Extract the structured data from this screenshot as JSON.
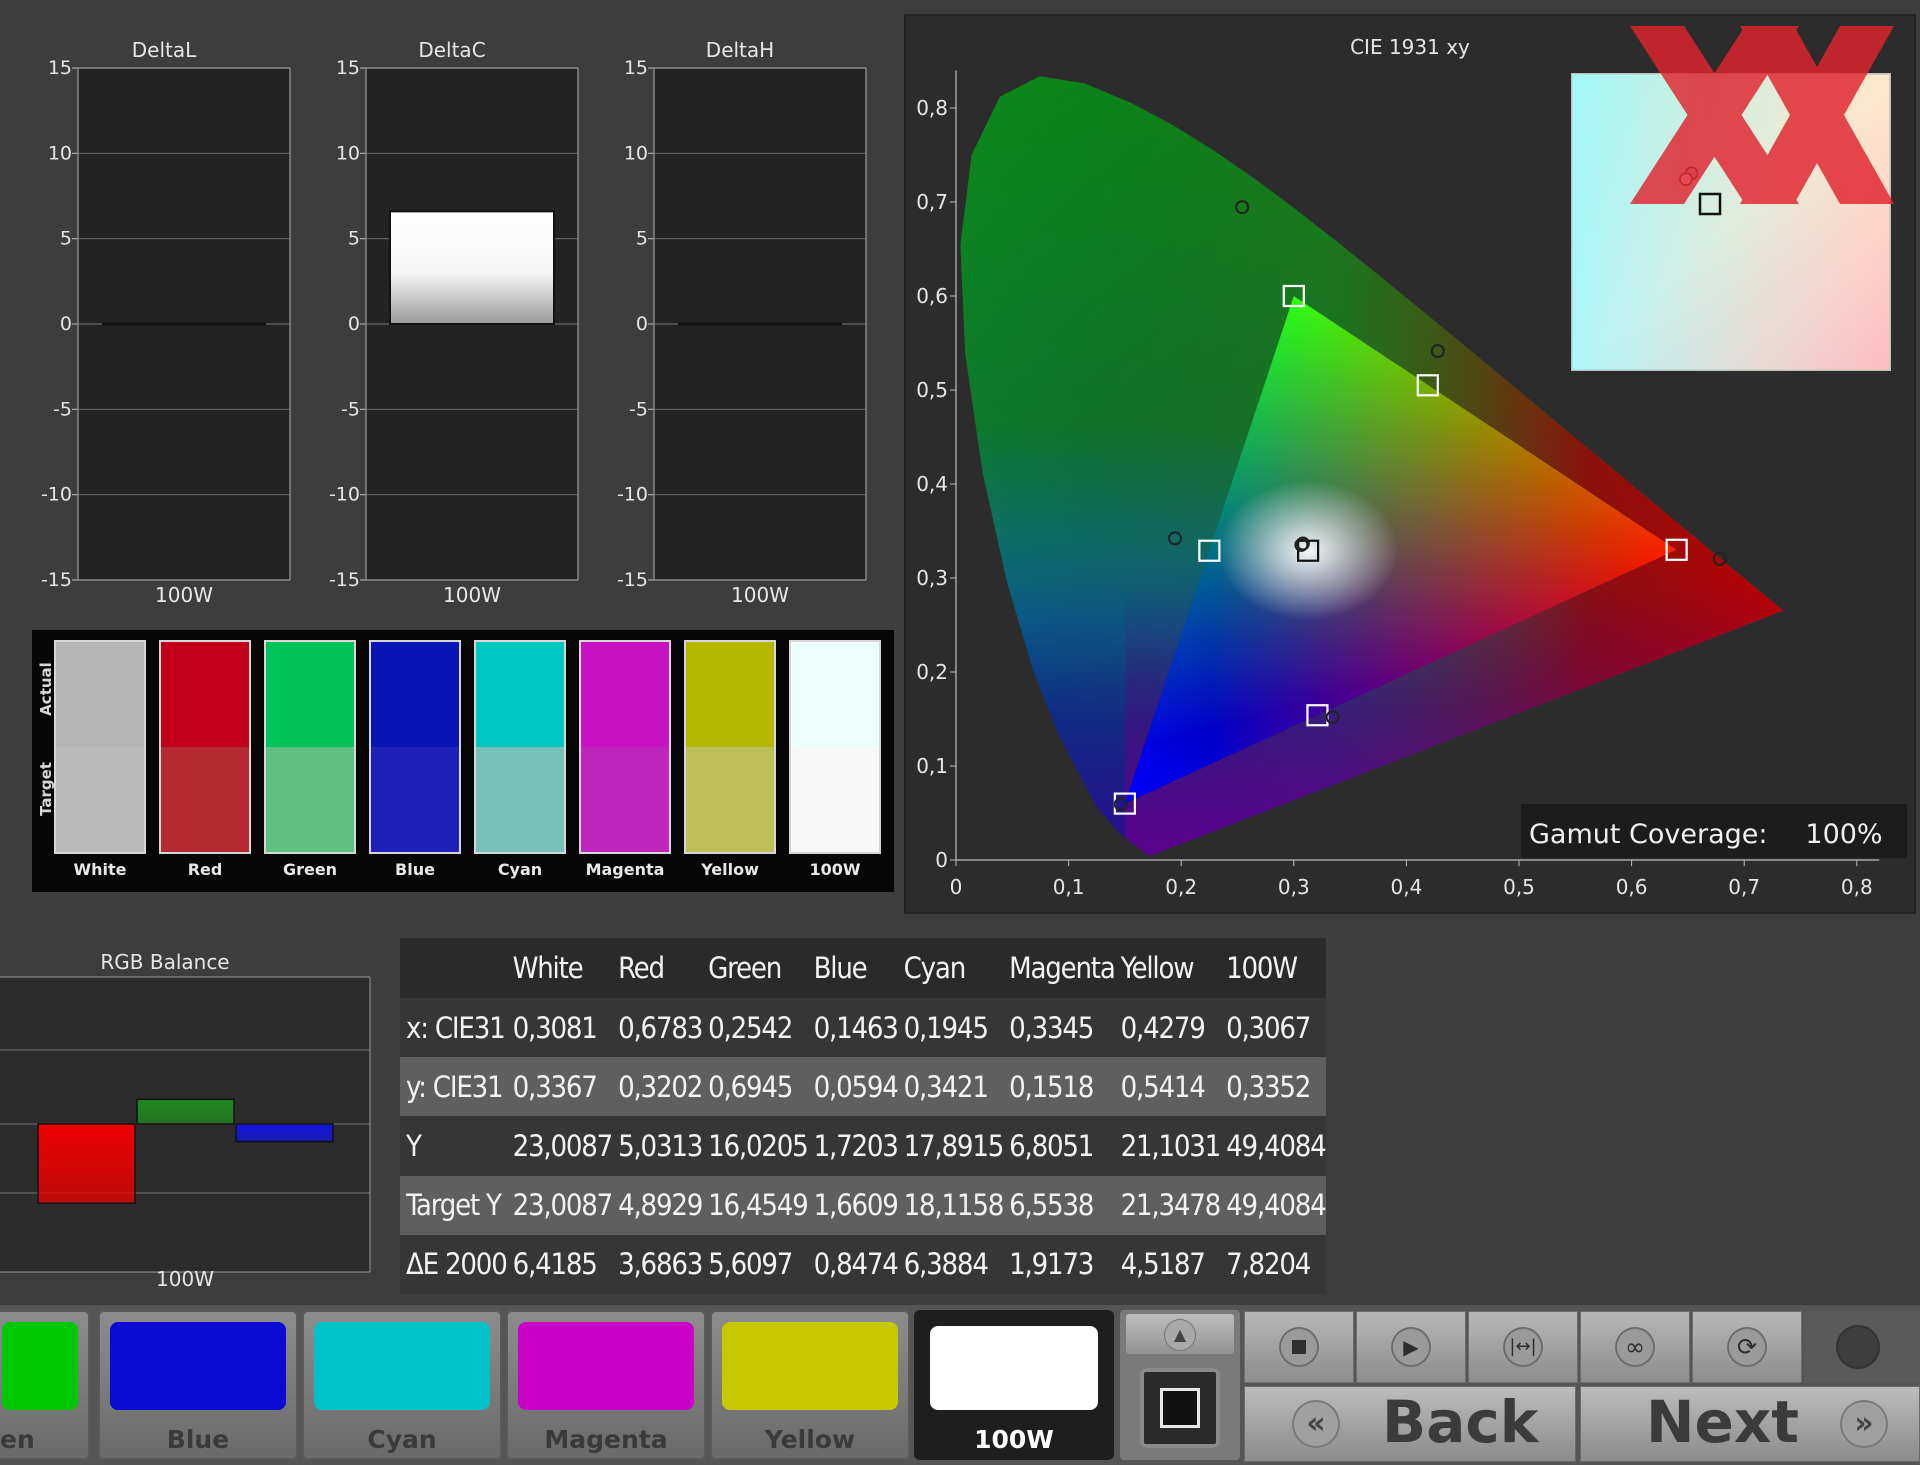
{
  "delta_charts": [
    {
      "title": "DeltaL",
      "ticks": [
        "15",
        "10",
        "5",
        "0",
        "-5",
        "-10",
        "-15"
      ],
      "category": "100W",
      "value": 0
    },
    {
      "title": "DeltaC",
      "ticks": [
        "15",
        "10",
        "5",
        "0",
        "-5",
        "-10",
        "-15"
      ],
      "category": "100W",
      "value": 6.6
    },
    {
      "title": "DeltaH",
      "ticks": [
        "15",
        "10",
        "5",
        "0",
        "-5",
        "-10",
        "-15"
      ],
      "category": "100W",
      "value": 0
    }
  ],
  "swatches": {
    "actual_label": "Actual",
    "target_label": "Target",
    "items": [
      {
        "label": "White",
        "actual": "#b4b4b4",
        "target": "#b9b9b9"
      },
      {
        "label": "Red",
        "actual": "#c3001b",
        "target": "#b52a31"
      },
      {
        "label": "Green",
        "actual": "#00c358",
        "target": "#5ec182"
      },
      {
        "label": "Blue",
        "actual": "#0a15b8",
        "target": "#1e20b7"
      },
      {
        "label": "Cyan",
        "actual": "#00c6c2",
        "target": "#76c1ba"
      },
      {
        "label": "Magenta",
        "actual": "#c813c4",
        "target": "#bd25bd"
      },
      {
        "label": "Yellow",
        "actual": "#b6b800",
        "target": "#bcbe58"
      },
      {
        "label": "100W",
        "actual": "#ebfffd",
        "target": "#f7f7f7"
      }
    ]
  },
  "cie": {
    "title": "CIE 1931 xy",
    "x_ticks": [
      "0",
      "0,1",
      "0,2",
      "0,3",
      "0,4",
      "0,5",
      "0,6",
      "0,7",
      "0,8"
    ],
    "y_ticks": [
      "0",
      "0,1",
      "0,2",
      "0,3",
      "0,4",
      "0,5",
      "0,6",
      "0,7",
      "0,8"
    ],
    "gamut_coverage_label": "Gamut Coverage:",
    "gamut_coverage_value": "100%",
    "targets": [
      {
        "name": "Red",
        "x": 0.64,
        "y": 0.33
      },
      {
        "name": "Green",
        "x": 0.3,
        "y": 0.6
      },
      {
        "name": "Blue",
        "x": 0.15,
        "y": 0.06
      },
      {
        "name": "Cyan",
        "x": 0.225,
        "y": 0.329
      },
      {
        "name": "Magenta",
        "x": 0.321,
        "y": 0.154
      },
      {
        "name": "Yellow",
        "x": 0.419,
        "y": 0.505
      },
      {
        "name": "White",
        "x": 0.3127,
        "y": 0.329
      }
    ],
    "measured": [
      {
        "name": "White",
        "x": 0.3081,
        "y": 0.3367
      },
      {
        "name": "Red",
        "x": 0.6783,
        "y": 0.3202
      },
      {
        "name": "Green",
        "x": 0.2542,
        "y": 0.6945
      },
      {
        "name": "Blue",
        "x": 0.1463,
        "y": 0.0594
      },
      {
        "name": "Cyan",
        "x": 0.1945,
        "y": 0.3421
      },
      {
        "name": "Magenta",
        "x": 0.3345,
        "y": 0.1518
      },
      {
        "name": "Yellow",
        "x": 0.4279,
        "y": 0.5414
      },
      {
        "name": "100W",
        "x": 0.3067,
        "y": 0.3352
      }
    ]
  },
  "rgb_balance": {
    "title": "RGB Balance",
    "category": "100W",
    "bars": [
      {
        "name": "Red",
        "value": -9,
        "color": "#ee0000"
      },
      {
        "name": "Green",
        "value": 2.8,
        "color": "#1f8a1f"
      },
      {
        "name": "Blue",
        "value": -2,
        "color": "#1515e0"
      }
    ]
  },
  "table": {
    "columns": [
      "White",
      "Red",
      "Green",
      "Blue",
      "Cyan",
      "Magenta",
      "Yellow",
      "100W"
    ],
    "rows": [
      {
        "label": "x: CIE31",
        "values": [
          "0,3081",
          "0,6783",
          "0,2542",
          "0,1463",
          "0,1945",
          "0,3345",
          "0,4279",
          "0,3067"
        ]
      },
      {
        "label": "y: CIE31",
        "values": [
          "0,3367",
          "0,3202",
          "0,6945",
          "0,0594",
          "0,3421",
          "0,1518",
          "0,5414",
          "0,3352"
        ]
      },
      {
        "label": "Y",
        "values": [
          "23,0087",
          "5,0313",
          "16,0205",
          "1,7203",
          "17,8915",
          "6,8051",
          "21,1031",
          "49,4084"
        ]
      },
      {
        "label": "Target Y",
        "values": [
          "23,0087",
          "4,8929",
          "16,4549",
          "1,6609",
          "18,1158",
          "6,5538",
          "21,3478",
          "49,4084"
        ]
      },
      {
        "label": "ΔE 2000",
        "values": [
          "6,4185",
          "3,6863",
          "5,6097",
          "0,8474",
          "6,3884",
          "1,9173",
          "4,5187",
          "7,8204"
        ]
      }
    ]
  },
  "toolbar": {
    "tiles": [
      {
        "label": "en",
        "color": "#00c800"
      },
      {
        "label": "Blue",
        "color": "#0a0ad2"
      },
      {
        "label": "Cyan",
        "color": "#00c0c8"
      },
      {
        "label": "Magenta",
        "color": "#c800c8"
      },
      {
        "label": "Yellow",
        "color": "#c8c800"
      },
      {
        "label": "100W",
        "color": "#ffffff"
      }
    ],
    "back_label": "Back",
    "next_label": "Next"
  }
}
